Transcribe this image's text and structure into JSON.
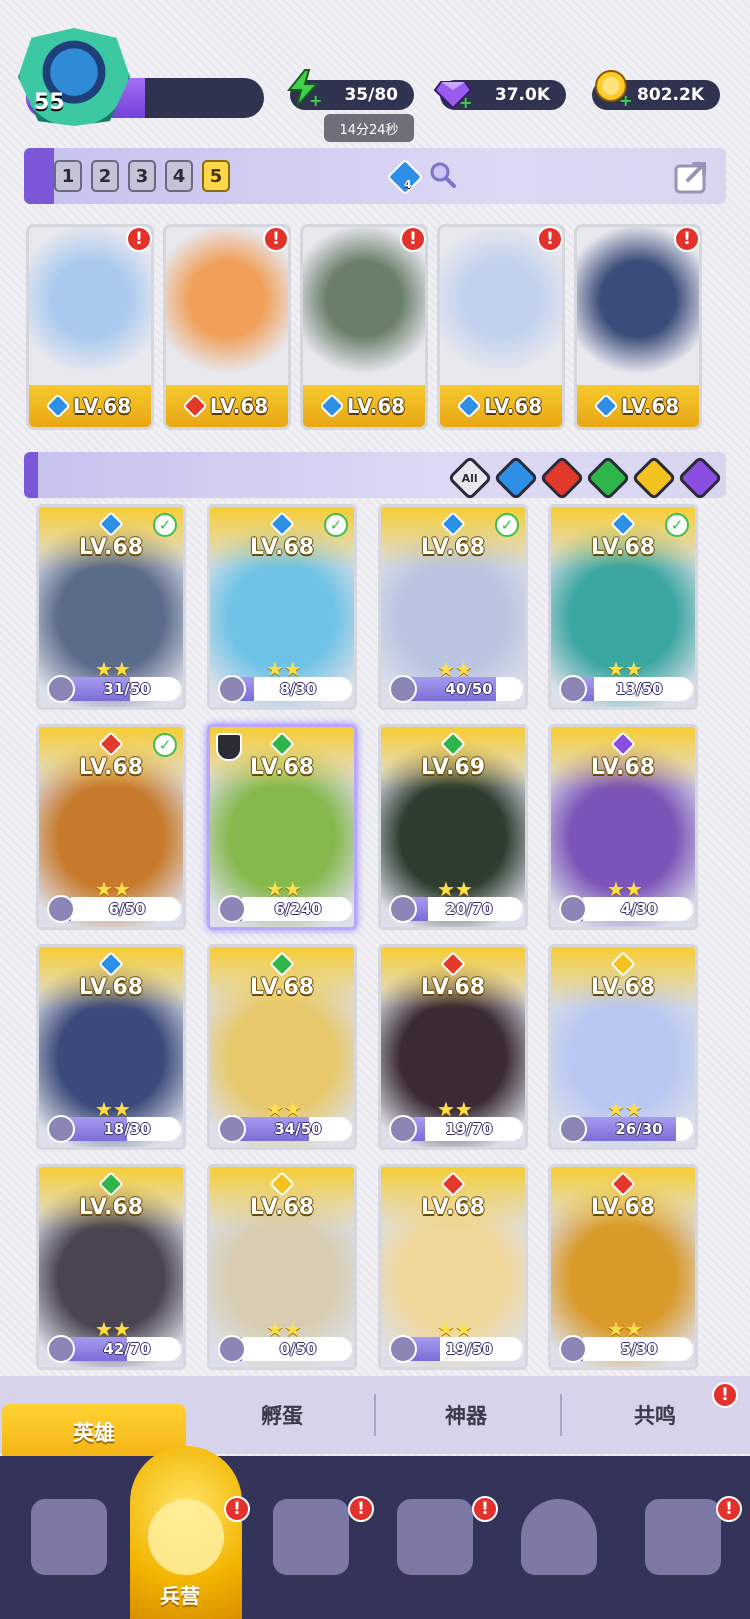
{
  "player": {
    "level": "55",
    "level_progress": 0.5
  },
  "resources": {
    "energy": {
      "value": "35/80",
      "timer": "14分24秒",
      "icon": "lightning-icon"
    },
    "gems": {
      "value": "37.0K",
      "icon": "diamond-icon"
    },
    "coins": {
      "value": "802.2K",
      "icon": "coin-icon"
    }
  },
  "team": {
    "slots": [
      "1",
      "2",
      "3",
      "4",
      "5"
    ],
    "active_slot": "5",
    "gem_badge": "4",
    "heroes": [
      {
        "level": "LV.68",
        "element": "water",
        "color": "#2d8fe6"
      },
      {
        "level": "LV.68",
        "element": "fire",
        "color": "#e2392b"
      },
      {
        "level": "LV.68",
        "element": "water",
        "color": "#2d8fe6"
      },
      {
        "level": "LV.68",
        "element": "water",
        "color": "#2d8fe6"
      },
      {
        "level": "LV.68",
        "element": "water",
        "color": "#2d8fe6"
      }
    ]
  },
  "filters": [
    {
      "label": "All",
      "color": "#e8e8ee"
    },
    {
      "label": "",
      "color": "#2d8fe6"
    },
    {
      "label": "",
      "color": "#e2392b"
    },
    {
      "label": "",
      "color": "#2fb64a"
    },
    {
      "label": "",
      "color": "#f3c21f"
    },
    {
      "label": "",
      "color": "#8a4fe0"
    }
  ],
  "heroes": [
    {
      "level": "LV.68",
      "element_color": "#2d8fe6",
      "progress": "31/50",
      "ratio": 0.62,
      "checked": true,
      "art": "#5b6b8a"
    },
    {
      "level": "LV.68",
      "element_color": "#2d8fe6",
      "progress": "8/30",
      "ratio": 0.27,
      "checked": true,
      "art": "#6fc3e6"
    },
    {
      "level": "LV.68",
      "element_color": "#2d8fe6",
      "progress": "40/50",
      "ratio": 0.8,
      "checked": true,
      "art": "#b8c4e0"
    },
    {
      "level": "LV.68",
      "element_color": "#2d8fe6",
      "progress": "13/50",
      "ratio": 0.26,
      "checked": true,
      "art": "#3aa6a0"
    },
    {
      "level": "LV.68",
      "element_color": "#e2392b",
      "progress": "6/50",
      "ratio": 0.12,
      "checked": true,
      "art": "#c77a2b"
    },
    {
      "level": "LV.68",
      "element_color": "#2fb64a",
      "progress": "6/240",
      "ratio": 0.03,
      "checked": false,
      "shield": true,
      "selected": true,
      "art": "#87b84e"
    },
    {
      "level": "LV.69",
      "element_color": "#2fb64a",
      "progress": "20/70",
      "ratio": 0.29,
      "checked": false,
      "art": "#2e3d2f"
    },
    {
      "level": "LV.68",
      "element_color": "#8a4fe0",
      "progress": "4/30",
      "ratio": 0.13,
      "checked": false,
      "art": "#7b55b8"
    },
    {
      "level": "LV.68",
      "element_color": "#2d8fe6",
      "progress": "18/30",
      "ratio": 0.6,
      "checked": false,
      "art": "#3b4a7a"
    },
    {
      "level": "LV.68",
      "element_color": "#2fb64a",
      "progress": "34/50",
      "ratio": 0.68,
      "checked": false,
      "art": "#e8c86a"
    },
    {
      "level": "LV.68",
      "element_color": "#e2392b",
      "progress": "19/70",
      "ratio": 0.27,
      "checked": false,
      "art": "#3a2a34"
    },
    {
      "level": "LV.68",
      "element_color": "#f3c21f",
      "progress": "26/30",
      "ratio": 0.87,
      "checked": false,
      "art": "#b9c8f2"
    },
    {
      "level": "LV.68",
      "element_color": "#2fb64a",
      "progress": "42/70",
      "ratio": 0.6,
      "checked": false,
      "art": "#4a4452"
    },
    {
      "level": "LV.68",
      "element_color": "#f3c21f",
      "progress": "0/50",
      "ratio": 0.0,
      "checked": false,
      "art": "#d8cdb2"
    },
    {
      "level": "LV.68",
      "element_color": "#e2392b",
      "progress": "19/50",
      "ratio": 0.38,
      "checked": false,
      "art": "#f0d79a"
    },
    {
      "level": "LV.68",
      "element_color": "#e2392b",
      "progress": "5/30",
      "ratio": 0.17,
      "checked": false,
      "art": "#d99a2a"
    }
  ],
  "tabs": [
    "英雄",
    "孵蛋",
    "神器",
    "共鸣"
  ],
  "nav": {
    "items": [
      "cards-icon",
      "barracks-icon",
      "book-icon",
      "castle-icon",
      "mushroom-icon",
      "banner-icon"
    ],
    "active_label": "兵营"
  },
  "alert_mark": "!"
}
